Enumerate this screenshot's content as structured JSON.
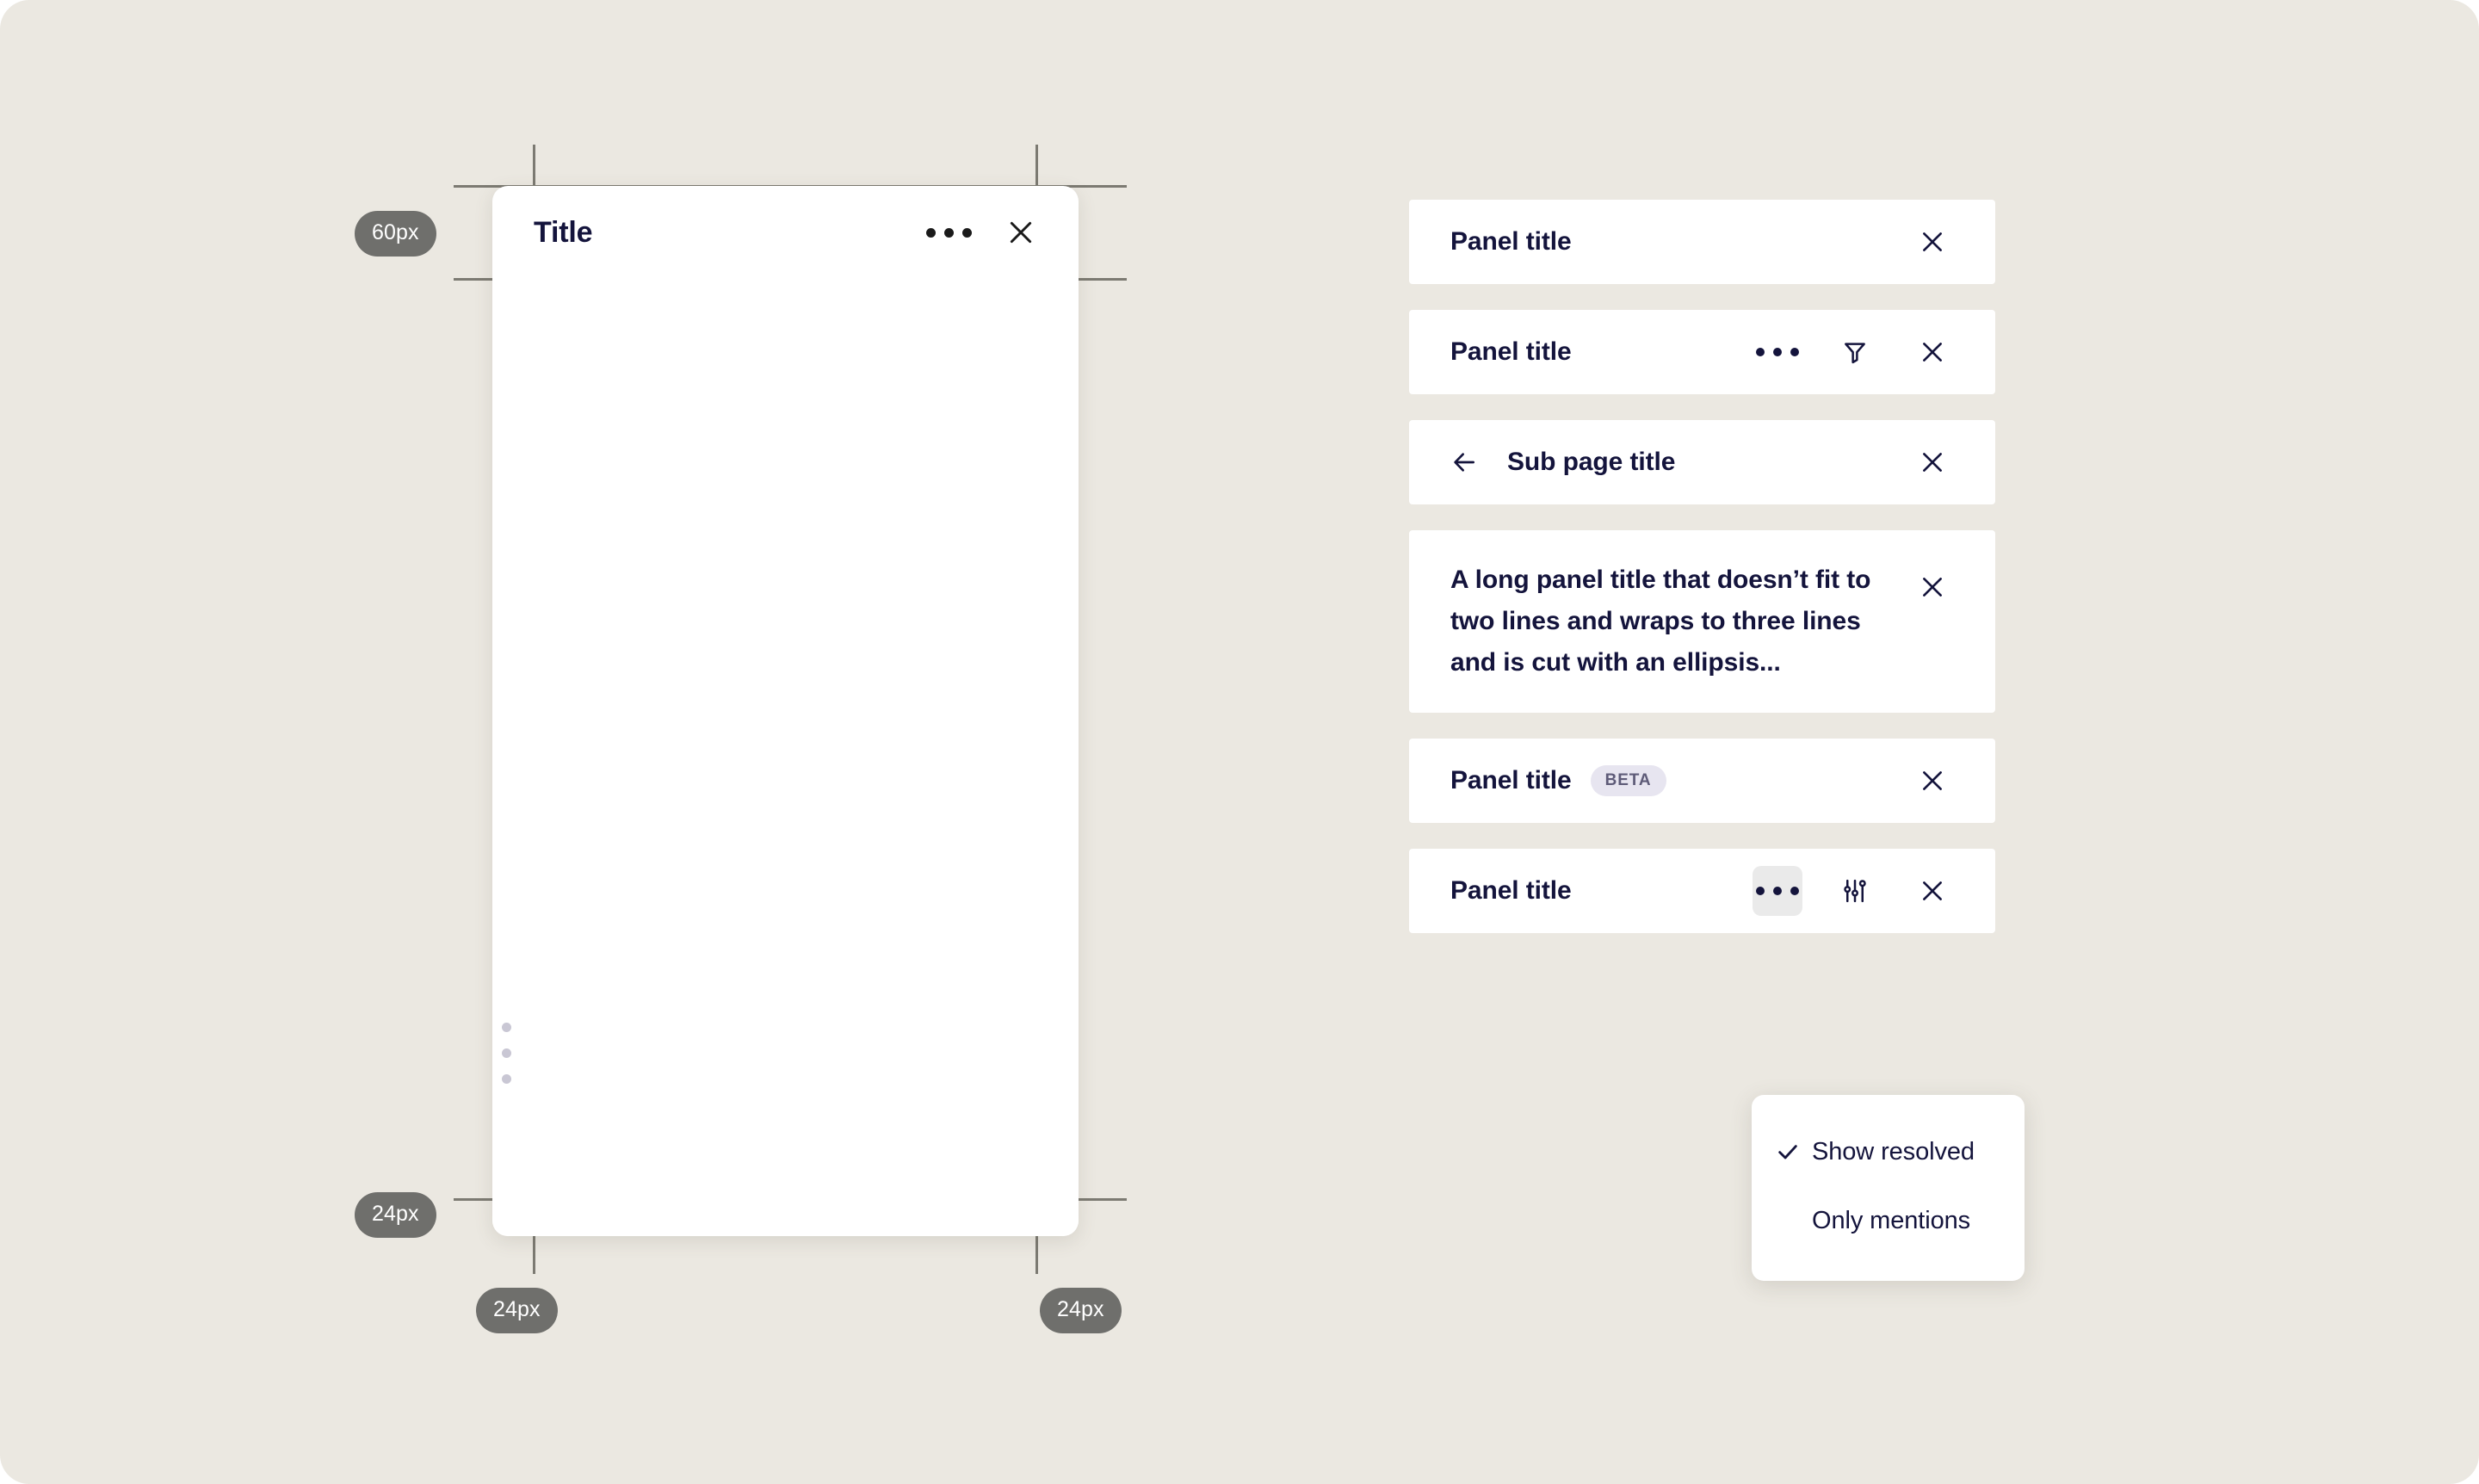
{
  "canvas": {
    "background_color": "#EBE8E1"
  },
  "spec": {
    "panel": {
      "title": "Title",
      "more_icon": "more-horizontal-icon",
      "close_icon": "close-icon",
      "drag_handle_icon": "drag-handle-dots-icon"
    },
    "measurements": [
      {
        "label": "60px",
        "name": "header-height-badge"
      },
      {
        "label": "24px",
        "name": "bottom-padding-badge"
      },
      {
        "label": "24px",
        "name": "left-padding-badge"
      },
      {
        "label": "24px",
        "name": "right-padding-badge"
      }
    ]
  },
  "panels": [
    {
      "title": "Panel title",
      "actions": [
        "close-icon"
      ]
    },
    {
      "title": "Panel title",
      "actions": [
        "more-horizontal-icon",
        "filter-icon",
        "close-icon"
      ]
    },
    {
      "title": "Sub page title",
      "back_icon": "arrow-left-icon",
      "actions": [
        "close-icon"
      ]
    },
    {
      "title": "A long panel title that doesn’t fit to two lines and wraps to three lines and is cut with an ellipsis...",
      "actions": [
        "close-icon"
      ]
    },
    {
      "title": "Panel title",
      "badge": "BETA",
      "actions": [
        "close-icon"
      ]
    },
    {
      "title": "Panel title",
      "actions": [
        "more-horizontal-icon",
        "sliders-icon",
        "close-icon"
      ]
    }
  ],
  "dropdown": {
    "items": [
      {
        "label": "Show resolved",
        "checked": true
      },
      {
        "label": "Only mentions",
        "checked": false
      }
    ]
  },
  "colors": {
    "background": "#EBE8E1",
    "panel_surface": "#FFFFFF",
    "text_primary": "#14143C",
    "guide_line": "#7C7A72",
    "badge_bg": "#6F6F6C",
    "badge_text": "#FFFFFF",
    "beta_bg": "#E7E5F0",
    "beta_text": "#5E5B78",
    "pressed_bg": "#EAEAEA",
    "drag_dot": "#C9C7D4"
  }
}
